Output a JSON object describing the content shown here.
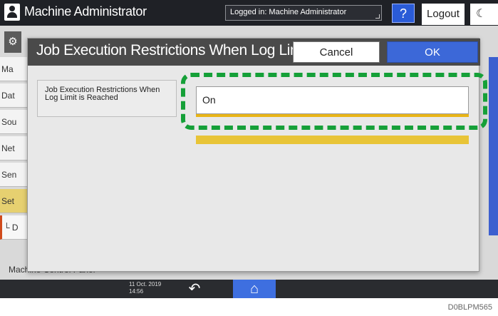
{
  "header": {
    "title": "Machine Administrator",
    "logged_in": "Logged in: Machine Administrator",
    "help_label": "?",
    "logout_label": "Logout",
    "moon_glyph": "☾"
  },
  "background_menu": {
    "items": [
      {
        "label": "Ma"
      },
      {
        "label": "Dat"
      },
      {
        "label": "Sou"
      },
      {
        "label": "Net"
      },
      {
        "label": "Sen"
      },
      {
        "label": "Set"
      },
      {
        "label": "└ D"
      }
    ],
    "footer_text": "Machine Control Panel"
  },
  "dialog": {
    "title": "Job Execution Restrictions When Log Limit is...",
    "cancel_label": "Cancel",
    "ok_label": "OK",
    "setting_label": "Job Execution Restrictions When Log Limit is Reached",
    "value": "On"
  },
  "footer": {
    "date": "11 Oct. 2019",
    "time": "14:56",
    "back_glyph": "↶",
    "home_glyph": "⌂"
  },
  "figure_code": "D0BLPM565",
  "colors": {
    "accent_blue": "#3c68d8",
    "highlight_green": "#15a038",
    "focus_yellow": "#e8b417"
  }
}
